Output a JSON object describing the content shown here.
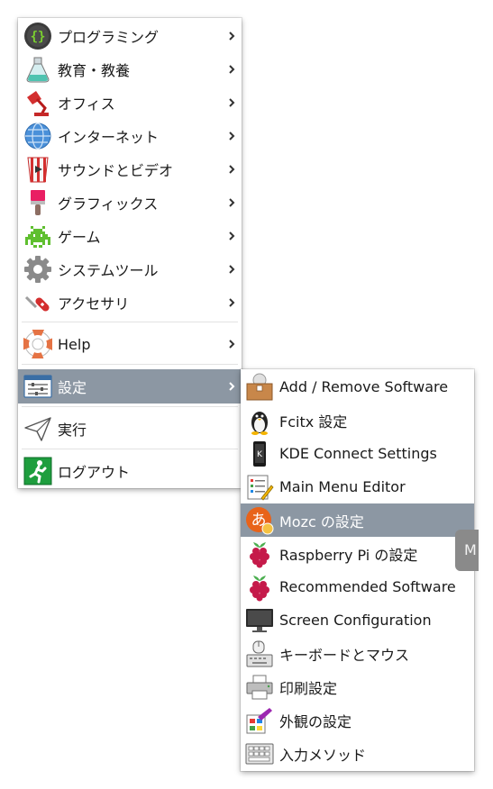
{
  "main_menu": {
    "items": [
      {
        "label": "プログラミング",
        "icon": "programming-icon"
      },
      {
        "label": "教育・教養",
        "icon": "education-flask-icon"
      },
      {
        "label": "オフィス",
        "icon": "office-lamp-icon"
      },
      {
        "label": "インターネット",
        "icon": "globe-icon"
      },
      {
        "label": "サウンドとビデオ",
        "icon": "popcorn-icon"
      },
      {
        "label": "グラフィックス",
        "icon": "paintbrush-icon"
      },
      {
        "label": "ゲーム",
        "icon": "space-invader-icon"
      },
      {
        "label": "システムツール",
        "icon": "gear-icon"
      },
      {
        "label": "アクセサリ",
        "icon": "swiss-knife-icon"
      },
      {
        "label": "Help",
        "icon": "lifebuoy-icon"
      },
      {
        "label": "設定",
        "icon": "preferences-sliders-icon"
      },
      {
        "label": "実行",
        "icon": "paper-plane-icon"
      },
      {
        "label": "ログアウト",
        "icon": "exit-running-man-icon"
      }
    ]
  },
  "sub_menu": {
    "items": [
      {
        "label": "Add / Remove Software",
        "icon": "package-add-icon"
      },
      {
        "label": "Fcitx 設定",
        "icon": "penguin-keyboard-icon"
      },
      {
        "label": "KDE Connect Settings",
        "icon": "kde-connect-phone-icon"
      },
      {
        "label": "Main Menu Editor",
        "icon": "menu-editor-icon"
      },
      {
        "label": "Mozc の設定",
        "icon": "mozc-icon"
      },
      {
        "label": "Raspberry Pi の設定",
        "icon": "raspberry-icon"
      },
      {
        "label": "Recommended Software",
        "icon": "raspberry-icon"
      },
      {
        "label": "Screen Configuration",
        "icon": "monitor-icon"
      },
      {
        "label": "キーボードとマウス",
        "icon": "keyboard-mouse-icon"
      },
      {
        "label": "印刷設定",
        "icon": "printer-icon"
      },
      {
        "label": "外観の設定",
        "icon": "appearance-palette-icon"
      },
      {
        "label": "入力メソッド",
        "icon": "input-method-keyboard-icon"
      }
    ]
  },
  "tooltip": {
    "text": "M"
  },
  "colors": {
    "selected_bg": "#8c97a3",
    "selected_text": "#ffffff"
  }
}
